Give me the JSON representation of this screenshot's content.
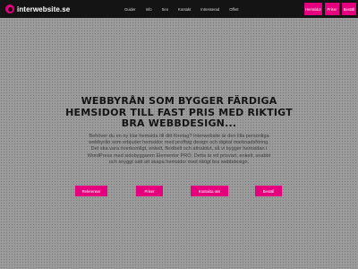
{
  "brand": {
    "name": "interwebsite.se"
  },
  "nav": {
    "items": [
      "Guider",
      "Info",
      "Seo",
      "Kontakt",
      "Intresserad",
      "Offert"
    ]
  },
  "header_buttons": [
    "Hemsidor",
    "Priser",
    "Beställ"
  ],
  "hero": {
    "heading": "WEBBYRÅN SOM BYGGER FÄRDIGA HEMSIDOR TILL FAST PRIS MED RIKTIGT BRA WEBBDESIGN...",
    "body": "Behöver du en ny klar hemsida till ditt företag? Interwebsite är den lilla personliga webbyrån som erbjuder hemsidor med proffsig design och digital marknadsföring. Det ska vara överkomligt, enkelt, flexibelt och attraktivt, så vi bygger hemsidan i WordPress med sidobyggaren Elementor PRO. Detta är ett prisvärt, enkelt, snabbt och snyggt sätt att skapa hemsidor med riktigt bra webbdesign."
  },
  "cta_buttons": [
    "Referenser",
    "Priser",
    "Kontakta oss",
    "Beställ"
  ],
  "colors": {
    "accent": "#e5007e",
    "topbar": "#141414",
    "background": "#9b9b9b"
  }
}
